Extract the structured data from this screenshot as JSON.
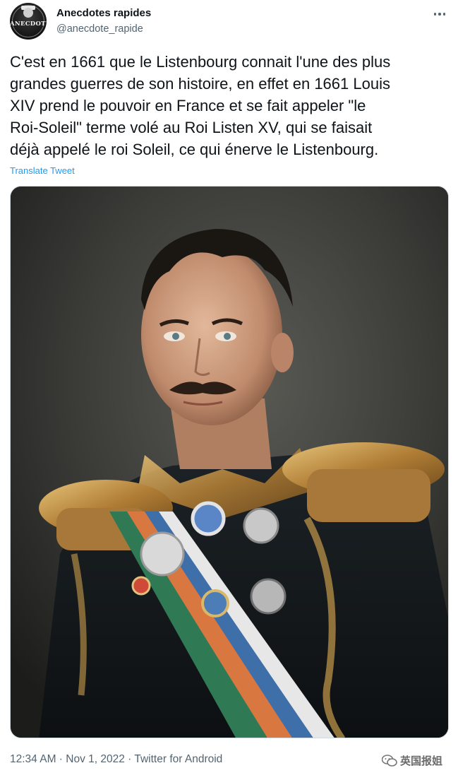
{
  "account": {
    "name": "Anecdotes rapides",
    "handle": "@anecdote_rapide",
    "avatar_text": "ANECDOTE"
  },
  "menu": {
    "icon": "more-horizontal-icon"
  },
  "tweet": {
    "text": "C'est en 1661 que le Listenbourg connait l'une des plus\ngrandes guerres de son histoire, en effet en 1661 Louis\nXIV prend le pouvoir en France et se fait appeler \"le\nRoi-Soleil\" terme volé au Roi Listen XV, qui se faisait\ndéjà appelé le roi Soleil, ce qui énerve le Listenbourg.",
    "translate_label": "Translate Tweet",
    "time": "12:34 AM",
    "separator1": " · ",
    "date": "Nov 1, 2022",
    "separator2": " · ",
    "source": "Twitter for Android"
  },
  "watermark": {
    "text": "英国报姐",
    "icon": "wechat-icon"
  },
  "colors": {
    "link": "#1d9bf0",
    "secondary": "#536471",
    "primary_text": "#0f1419"
  }
}
